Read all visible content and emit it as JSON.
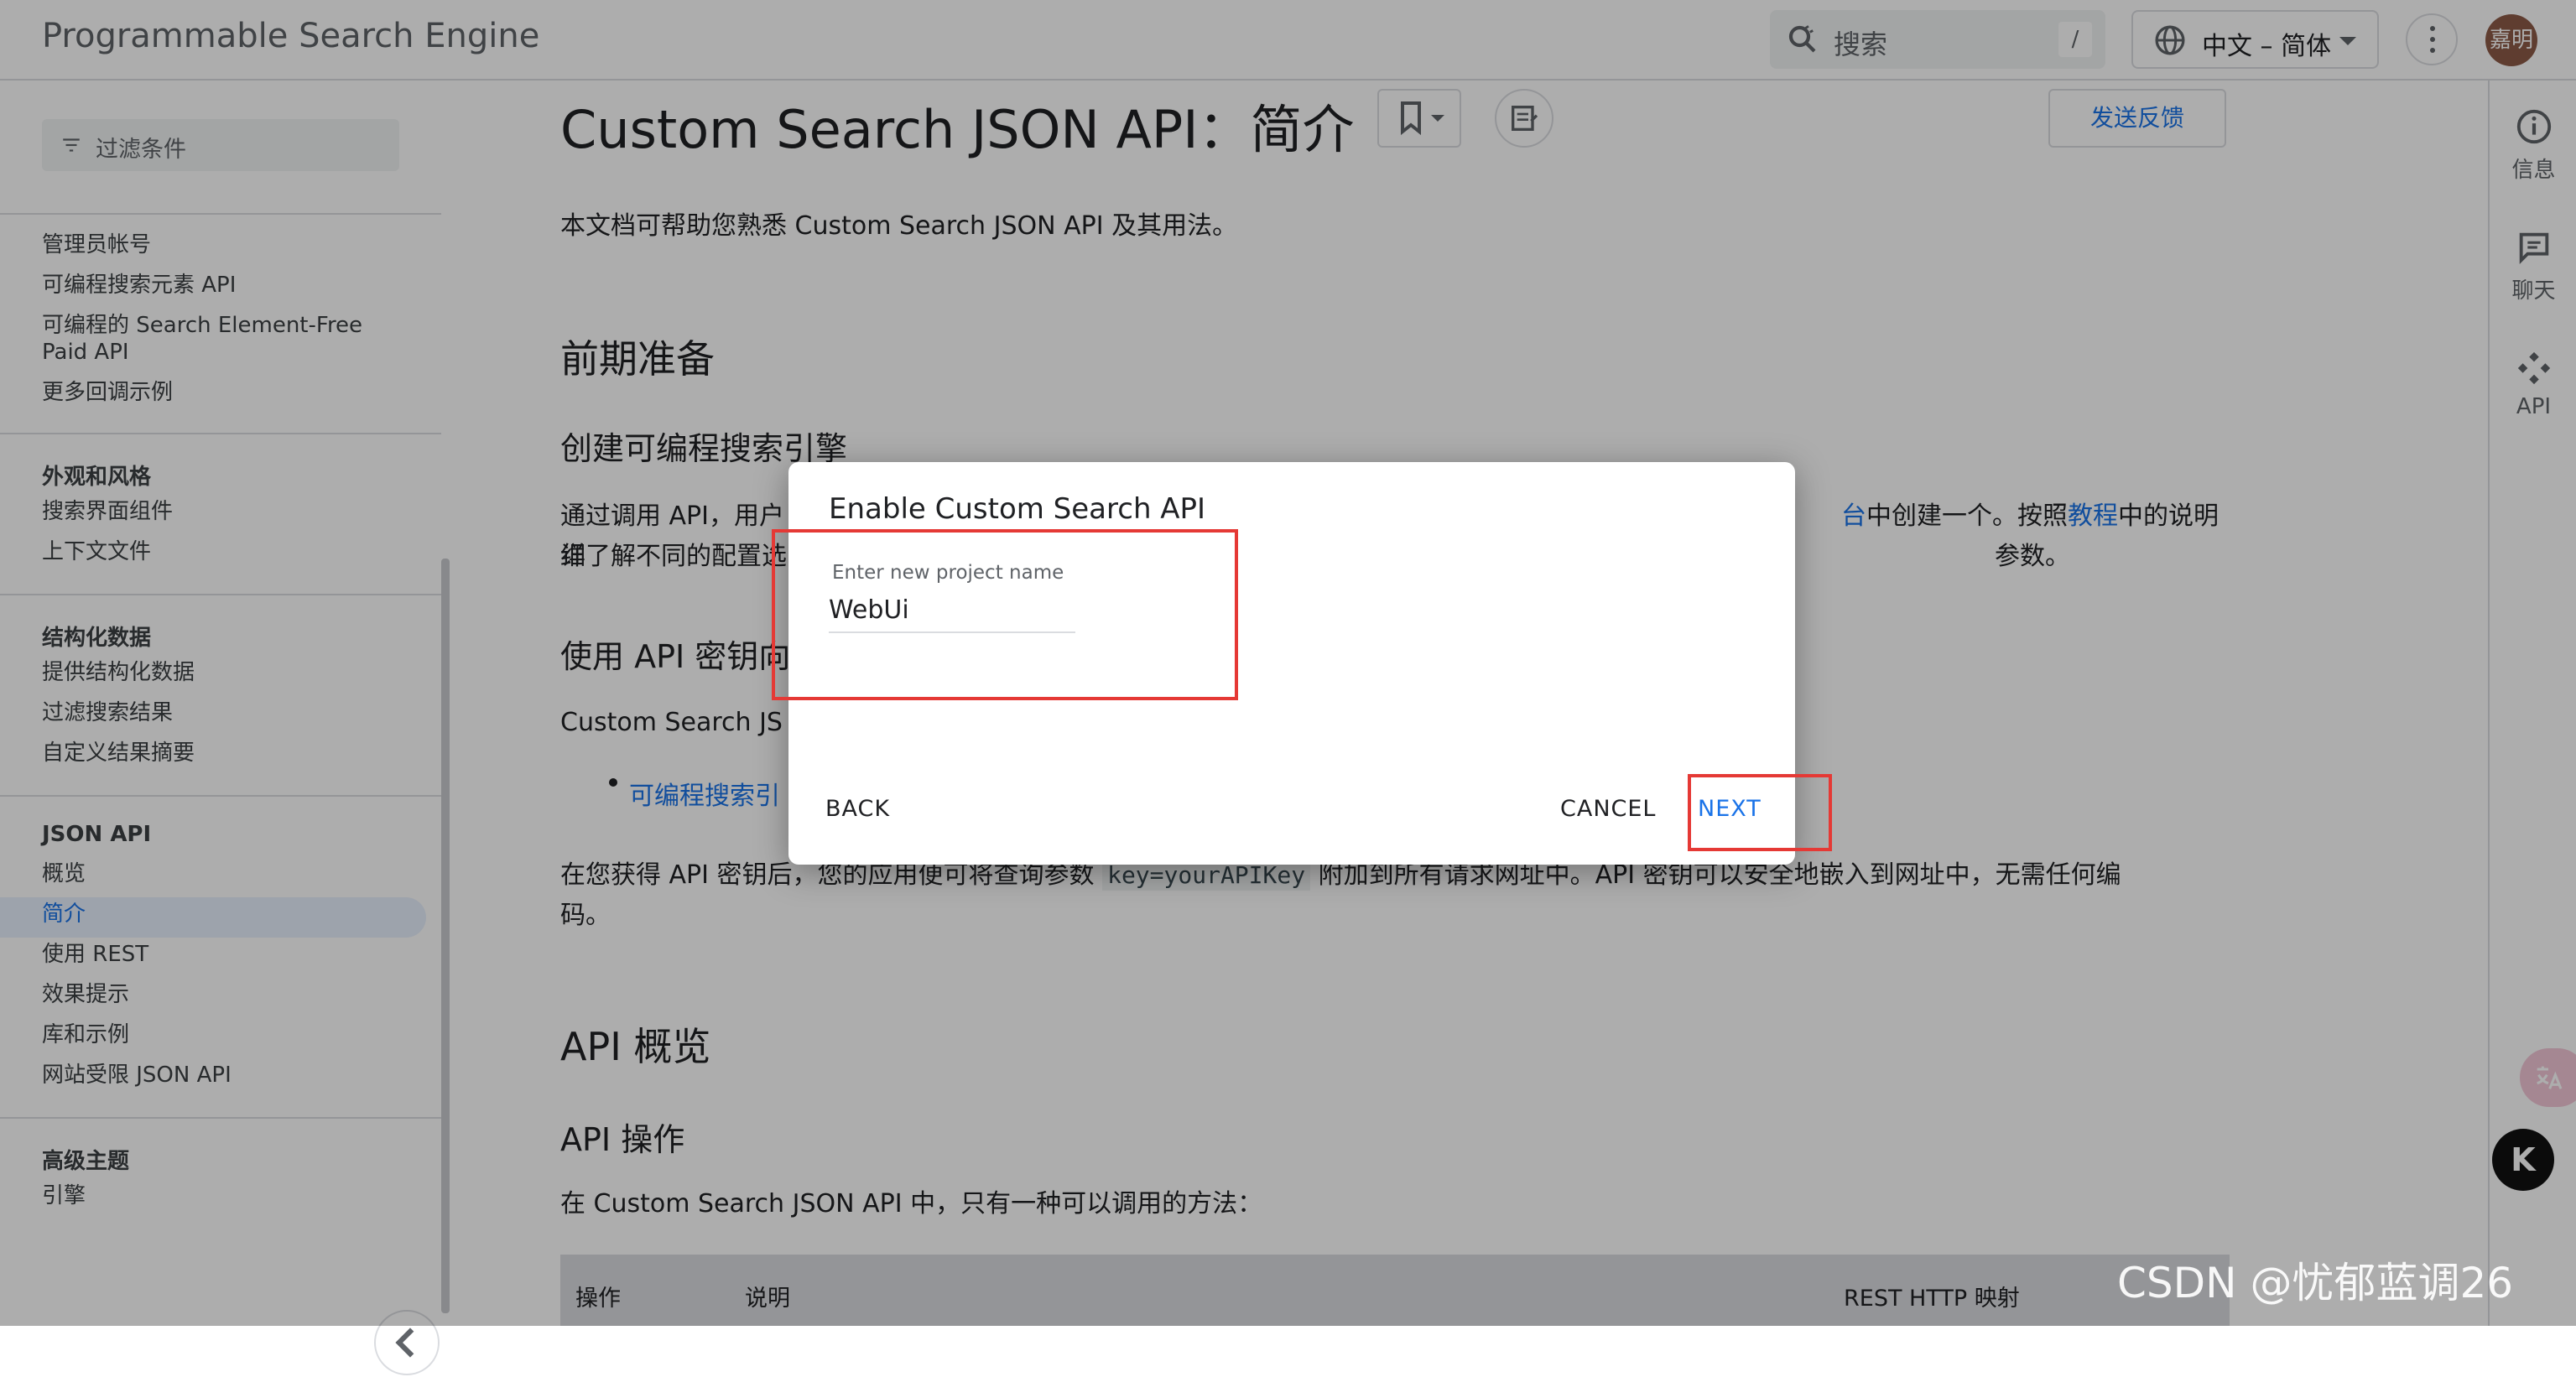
{
  "app": {
    "brand": "Programmable Search Engine",
    "search_placeholder": "搜索",
    "search_shortcut": "/",
    "language": "中文 – 简体",
    "avatar_text": "嘉明"
  },
  "sidebar": {
    "filter_placeholder": "过滤条件",
    "group1": [
      "管理员帐号",
      "可编程搜索元素 API",
      "可编程的 Search Element-Free Paid API",
      "更多回调示例"
    ],
    "group2_head": "外观和风格",
    "group2": [
      "搜索界面组件",
      "上下文文件"
    ],
    "group3_head": "结构化数据",
    "group3": [
      "提供结构化数据",
      "过滤搜索结果",
      "自定义结果摘要"
    ],
    "group4_head": "JSON API",
    "group4": [
      "概览",
      "简介",
      "使用 REST",
      "效果提示",
      "库和示例",
      "网站受限 JSON API"
    ],
    "active_item": "简介",
    "group5_head": "高级主题",
    "group5": [
      "引擎"
    ]
  },
  "main": {
    "title": "Custom Search JSON API：简介",
    "feedback": "发送反馈",
    "intro": "本文档可帮助您熟悉 Custom Search JSON API 及其用法。",
    "h2_prereq": "前期准备",
    "h3_create": "创建可编程搜索引擎",
    "para_create_1a": "通过调用 API，用户",
    "para_create_1_link": "台",
    "para_create_1b": "中创建一个。按照",
    "para_create_1_link2": "教程",
    "para_create_1c": "中的说明详",
    "para_create_2a": "细了解不同的配置选",
    "para_create_2b": "参数。",
    "h3_apikey": "使用 API 密钥向",
    "para_apikey": "Custom Search JS",
    "bullet_link": "可编程搜索引",
    "para_key_a": "在您获得 API 密钥后，您的应用便可将查询参数",
    "para_key_code": "key=yourAPIKey",
    "para_key_b": "附加到所有请求网址中。API 密钥可以安全地嵌入到网址中，无需任何编",
    "para_key_c": "码。",
    "h2_overview": "API 概览",
    "h3_ops": "API 操作",
    "para_ops": "在 Custom Search JSON API 中，只有一种可以调用的方法：",
    "table_headers": [
      "操作",
      "说明",
      "REST HTTP 映射"
    ]
  },
  "rail": {
    "info": "信息",
    "chat": "聊天",
    "api": "API"
  },
  "dialog": {
    "title": "Enable Custom Search API",
    "field_label": "Enter new project name",
    "field_value": "WebUi",
    "back": "BACK",
    "cancel": "CANCEL",
    "next": "NEXT"
  },
  "overlay": {
    "fab2": "K",
    "watermark": "CSDN @忧郁蓝调26"
  },
  "colors": {
    "accent": "#1a73e8",
    "highlight_box": "#e53935",
    "scrim": "rgba(0,0,0,0.32)"
  }
}
